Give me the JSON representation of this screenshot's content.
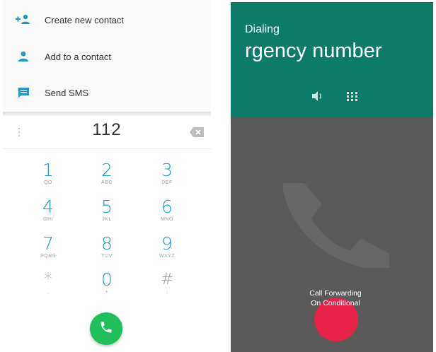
{
  "dialer": {
    "menu": [
      {
        "label": "Create new contact",
        "icon": "person-add-icon"
      },
      {
        "label": "Add to a contact",
        "icon": "person-icon"
      },
      {
        "label": "Send SMS",
        "icon": "message-icon"
      }
    ],
    "digits": "112",
    "keys": [
      {
        "num": "1",
        "letters": "QO"
      },
      {
        "num": "2",
        "letters": "ABC"
      },
      {
        "num": "3",
        "letters": "DEF"
      },
      {
        "num": "4",
        "letters": "GHI"
      },
      {
        "num": "5",
        "letters": "JKL"
      },
      {
        "num": "6",
        "letters": "MNO"
      },
      {
        "num": "7",
        "letters": "PQRS"
      },
      {
        "num": "8",
        "letters": "TUV"
      },
      {
        "num": "9",
        "letters": "WXYZ"
      },
      {
        "num": "*",
        "letters": ","
      },
      {
        "num": "0",
        "letters": "+"
      },
      {
        "num": "#",
        "letters": ";"
      }
    ],
    "call_button_color": "#1fc05a",
    "accent_color": "#2196c9"
  },
  "call": {
    "status": "Dialing",
    "caller": "rgency number",
    "forwarding_line1": "Call Forwarding",
    "forwarding_line2": "On Conditional",
    "header_color": "#0e7a68",
    "end_button_color": "#e8234a"
  }
}
